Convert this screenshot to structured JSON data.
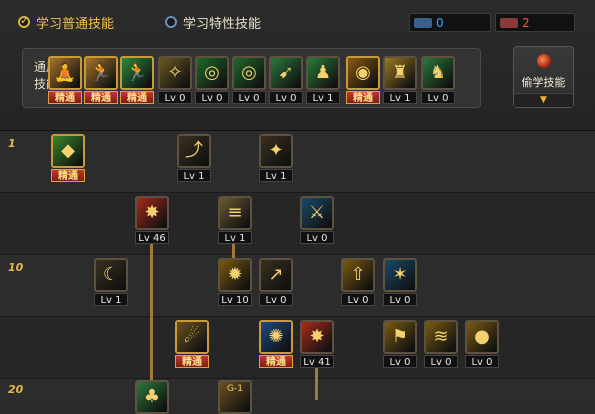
{
  "tabs": [
    {
      "label": "学习普通技能",
      "active": true
    },
    {
      "label": "学习特性技能",
      "active": false
    }
  ],
  "counters": [
    {
      "value": "0",
      "color": "#3aa8ff",
      "icon_color": "#3a5f8a",
      "icon": "sp-points-icon"
    },
    {
      "value": "2",
      "color": "#ff4a3a",
      "icon_color": "#8a3a3a",
      "icon": "tp-points-icon"
    }
  ],
  "common_skills_label": "通用技能",
  "steal_button_label": "偷学技能",
  "mastered_label": "精通",
  "row_levels": [
    "1",
    "",
    "10",
    "",
    "20"
  ],
  "common_skills": [
    {
      "cap": "精通",
      "mastered": true,
      "icon": "meditate-icon",
      "glyph": "🧘",
      "bg": "#a8742a"
    },
    {
      "cap": "精通",
      "mastered": true,
      "icon": "jump-icon",
      "glyph": "🏃",
      "bg": "#a8742a"
    },
    {
      "cap": "精通",
      "mastered": true,
      "icon": "dash-icon",
      "glyph": "🏃",
      "bg": "#2a8a3a"
    },
    {
      "cap": "Lv 0",
      "mastered": false,
      "icon": "wing-icon",
      "glyph": "✧",
      "bg": "#6a5a20"
    },
    {
      "cap": "Lv 0",
      "mastered": false,
      "icon": "target-icon",
      "glyph": "◎",
      "bg": "#1e6a2a"
    },
    {
      "cap": "Lv 0",
      "mastered": false,
      "icon": "crosshair-icon",
      "glyph": "◎",
      "bg": "#1e6a2a"
    },
    {
      "cap": "Lv 0",
      "mastered": false,
      "icon": "kick-icon",
      "glyph": "➹",
      "bg": "#2a7a3a"
    },
    {
      "cap": "Lv 1",
      "mastered": false,
      "icon": "shield-person-icon",
      "glyph": "♟",
      "bg": "#2a7a3a"
    },
    {
      "cap": "精通",
      "mastered": true,
      "icon": "eye-icon",
      "glyph": "◉",
      "bg": "#8a5a10"
    },
    {
      "cap": "Lv 1",
      "mastered": false,
      "icon": "strength-icon",
      "glyph": "♜",
      "bg": "#9a7a20"
    },
    {
      "cap": "Lv 0",
      "mastered": false,
      "icon": "stance-icon",
      "glyph": "♞",
      "bg": "#2a7a3a"
    }
  ],
  "tree_skills": [
    {
      "cap": "精通",
      "mastered": true,
      "icon": "green-cube-icon",
      "glyph": "◆",
      "bg": "#3a8a2a"
    },
    {
      "cap": "Lv 1",
      "mastered": false,
      "icon": "arrow-up-icon",
      "glyph": "⤴",
      "bg": "#3a3020"
    },
    {
      "cap": "Lv 1",
      "mastered": false,
      "icon": "slash-up-icon",
      "glyph": "✦",
      "bg": "#3a3020"
    },
    {
      "cap": "Lv 46",
      "mastered": false,
      "icon": "explosion-icon",
      "glyph": "✸",
      "bg": "#a82a1a"
    },
    {
      "cap": "Lv 1",
      "mastered": false,
      "icon": "speed-slash-icon",
      "glyph": "≡",
      "bg": "#6a5a30"
    },
    {
      "cap": "Lv 0",
      "mastered": false,
      "icon": "weapon-icon",
      "glyph": "⚔",
      "bg": "#1a4a6a"
    },
    {
      "cap": "Lv 1",
      "mastered": false,
      "icon": "crescent-slash-icon",
      "glyph": "☾",
      "bg": "#3a3020"
    },
    {
      "cap": "Lv 10",
      "mastered": false,
      "icon": "fire-burst-icon",
      "glyph": "✹",
      "bg": "#7a5a10"
    },
    {
      "cap": "Lv 0",
      "mastered": false,
      "icon": "thrust-icon",
      "glyph": "↗",
      "bg": "#3a3020"
    },
    {
      "cap": "Lv 0",
      "mastered": false,
      "icon": "rise-icon",
      "glyph": "⇧",
      "bg": "#7a5a10"
    },
    {
      "cap": "Lv 0",
      "mastered": false,
      "icon": "ice-spike-icon",
      "glyph": "✶",
      "bg": "#1a4a6a"
    },
    {
      "cap": "精通",
      "mastered": true,
      "icon": "wave-slash-icon",
      "glyph": "☄",
      "bg": "#6a5020"
    },
    {
      "cap": "精通",
      "mastered": true,
      "icon": "blue-burst-icon",
      "glyph": "✺",
      "bg": "#1a4a8a"
    },
    {
      "cap": "Lv 41",
      "mastered": false,
      "icon": "red-burst-icon",
      "glyph": "✸",
      "bg": "#a82a1a"
    },
    {
      "cap": "Lv 0",
      "mastered": false,
      "icon": "flag-icon",
      "glyph": "⚑",
      "bg": "#7a5a10"
    },
    {
      "cap": "Lv 0",
      "mastered": false,
      "icon": "sweep-icon",
      "glyph": "≋",
      "bg": "#7a5a10"
    },
    {
      "cap": "Lv 0",
      "mastered": false,
      "icon": "grenade-icon",
      "glyph": "●",
      "bg": "#7a5a10"
    },
    {
      "cap": "",
      "mastered": false,
      "icon": "green-skill-icon",
      "glyph": "♣",
      "bg": "#2a7a3a"
    },
    {
      "cap": "",
      "mastered": false,
      "icon": "g1-skill-icon",
      "glyph": "G-1",
      "bg": "#6a5020"
    }
  ]
}
